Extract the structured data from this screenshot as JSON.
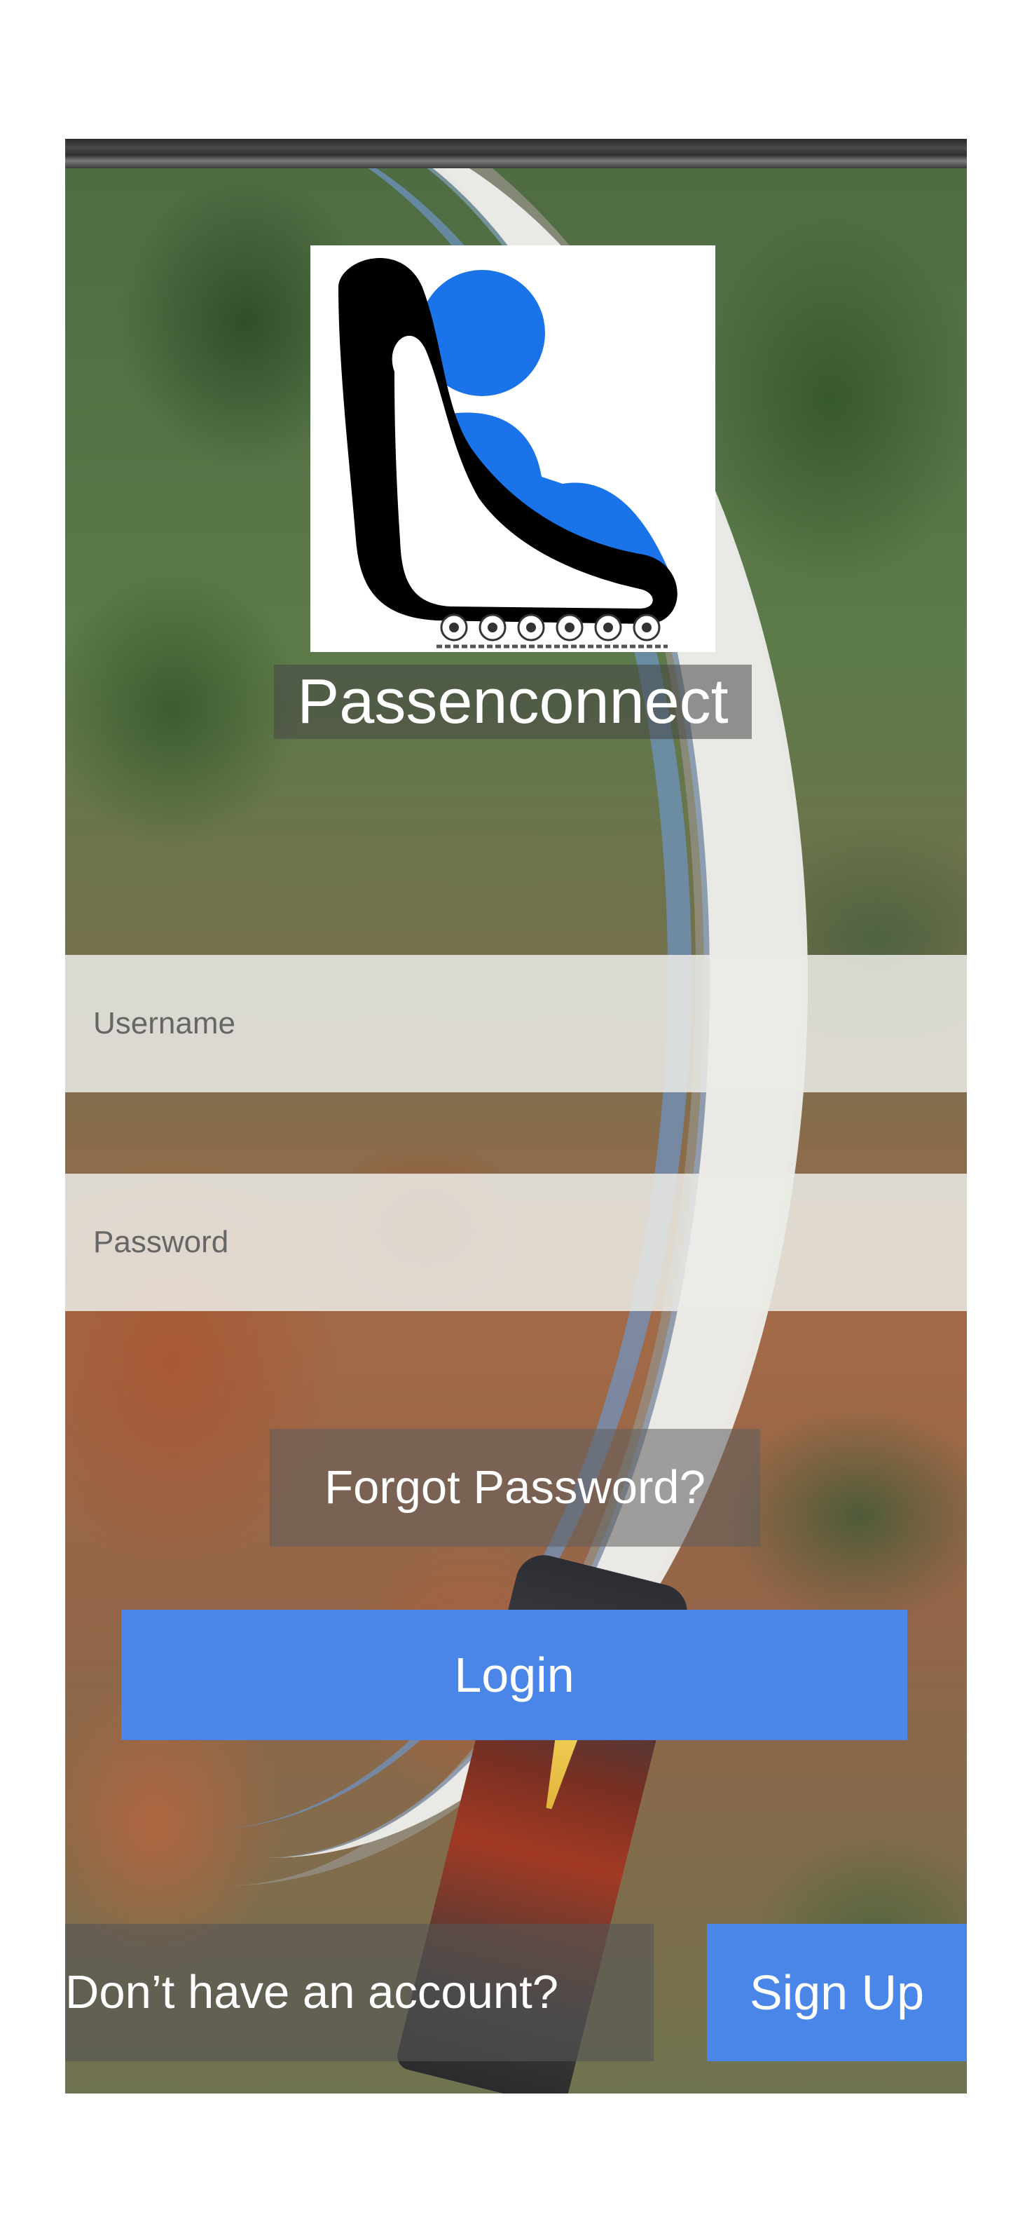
{
  "app": {
    "title": "Passenconnect"
  },
  "form": {
    "username_placeholder": "Username",
    "password_placeholder": "Password",
    "forgot_label": "Forgot Password?",
    "login_label": "Login"
  },
  "footer": {
    "no_account_text": "Don’t have an account?",
    "signup_label": "Sign Up"
  },
  "icons": {
    "logo": "passenconnect-seat-logo-icon"
  },
  "colors": {
    "accent": "#4a86e8",
    "logo_blue": "#1a73e8",
    "logo_black": "#000000"
  }
}
